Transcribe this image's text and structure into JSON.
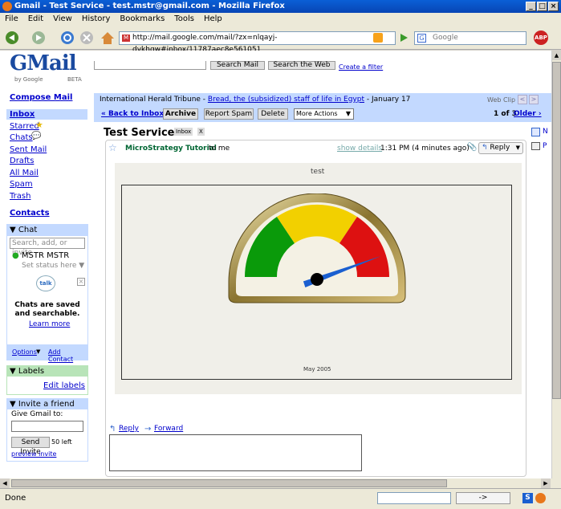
{
  "window": {
    "title": "Gmail - Test Service - test.mstr@gmail.com - Mozilla Firefox",
    "min": "_",
    "max": "□",
    "close": "×"
  },
  "menu": [
    "File",
    "Edit",
    "View",
    "History",
    "Bookmarks",
    "Tools",
    "Help"
  ],
  "address": "http://mail.google.com/mail/?zx=nlqayj-dykhqw#inbox/11787aec8e561051",
  "search_placeholder": "Google",
  "logo": {
    "beta": "BETA",
    "by": "by Google"
  },
  "top_buttons": {
    "search_mail": "Search Mail",
    "search_web": "Search the Web",
    "create_filter": "Create a filter"
  },
  "sidebar": {
    "compose": "Compose Mail",
    "inbox": "Inbox",
    "starred": "Starred",
    "chats": "Chats",
    "sent": "Sent Mail",
    "drafts": "Drafts",
    "all": "All Mail",
    "spam": "Spam",
    "trash": "Trash",
    "contacts": "Contacts"
  },
  "chat": {
    "header": "Chat",
    "search_placeholder": "Search, add, or invite",
    "user": "MSTR MSTR",
    "status": "Set status here",
    "promo1": "Chats are saved",
    "promo2": "and searchable.",
    "learn_more": "Learn more",
    "options": "Options",
    "add_contact": "Add Contact",
    "talk": "talk"
  },
  "labels": {
    "header": "Labels",
    "edit": "Edit labels"
  },
  "invite": {
    "header": "Invite a friend",
    "give": "Give Gmail to:",
    "send": "Send Invite",
    "left": "50 left",
    "preview": "preview invite"
  },
  "webclip": {
    "source": "International Herald Tribune - ",
    "headline": "Bread, the (subsidized) staff of life in Egypt",
    "date": " - January 17",
    "label": "Web Clip"
  },
  "toolbar": {
    "back": "« Back to Inbox",
    "archive": "Archive",
    "report_spam": "Report Spam",
    "delete": "Delete",
    "more_actions": "More Actions",
    "count": "1 of 3",
    "older": "Older ›"
  },
  "message": {
    "subject": "Test Service",
    "tag": "Inbox",
    "tag_x": "X",
    "from": "MicroStrategy Tutorial",
    "to": "to me",
    "show_details": "show details",
    "time": "1:31 PM (4 minutes ago)",
    "reply": "Reply",
    "chart_title": "test",
    "chart_footer": "May 2005",
    "reply_link": "Reply",
    "forward_link": "Forward"
  },
  "gauge_value": 0.9,
  "status": {
    "done": "Done",
    "go": "->"
  },
  "colors": {
    "green": "#0a9a0a",
    "yellow": "#f2d000",
    "red": "#dd1111",
    "needle": "#1a5fd0",
    "gmail_blue": "#c3d9ff"
  }
}
